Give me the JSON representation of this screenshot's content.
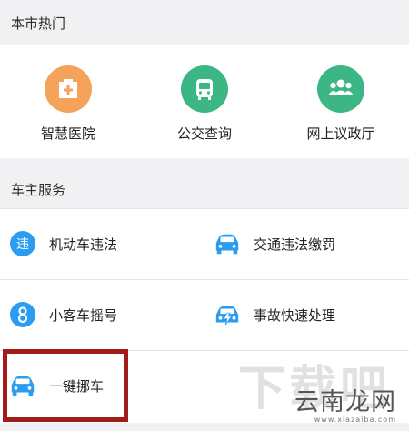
{
  "city_hot": {
    "title": "本市热门",
    "items": [
      {
        "label": "智慧医院",
        "icon": "hospital-icon",
        "color": "#f5a25b"
      },
      {
        "label": "公交查询",
        "icon": "bus-icon",
        "color": "#3cb684"
      },
      {
        "label": "网上议政厅",
        "icon": "people-icon",
        "color": "#3cb684"
      }
    ]
  },
  "car_services": {
    "title": "车主服务",
    "items": [
      {
        "label": "机动车违法",
        "icon": "violation-icon",
        "color": "#2a9df0"
      },
      {
        "label": "交通违法缴罚",
        "icon": "car-payment-icon",
        "color": "#2a9df0"
      },
      {
        "label": "小客车摇号",
        "icon": "lottery-icon",
        "color": "#2a9df0"
      },
      {
        "label": "事故快速处理",
        "icon": "car-accident-icon",
        "color": "#2a9df0"
      },
      {
        "label": "一键挪车",
        "icon": "move-car-icon",
        "color": "#2a9df0"
      }
    ]
  },
  "watermark": {
    "big": "下载吧",
    "main": "云南龙网",
    "url": "www.xiazaiba.com"
  },
  "colors": {
    "highlight": "#a31c1c",
    "background": "#f1f1f3"
  }
}
